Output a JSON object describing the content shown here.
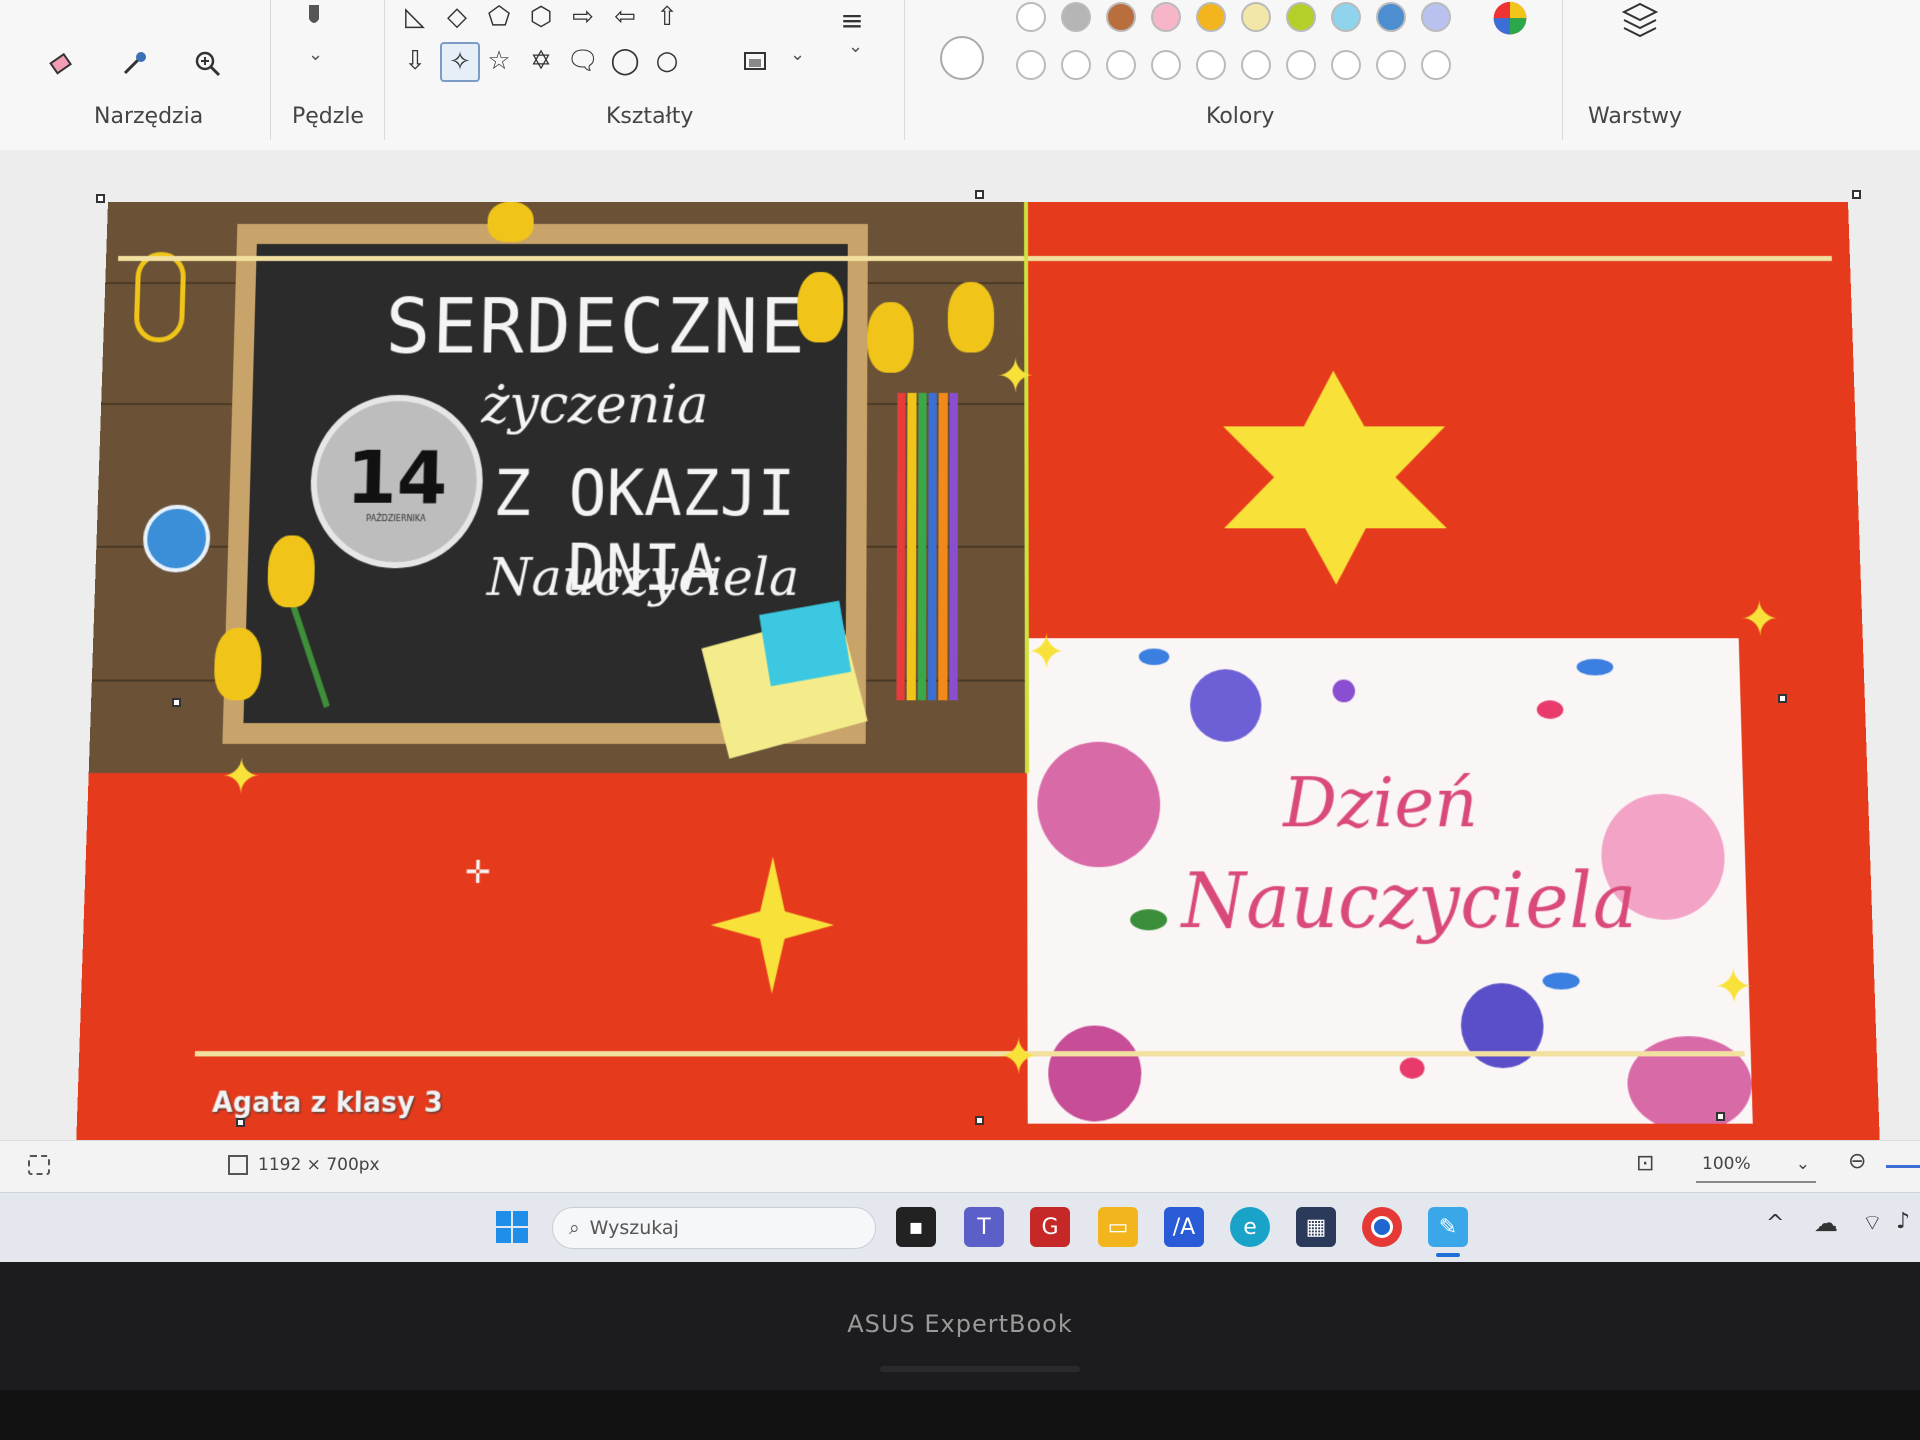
{
  "ribbon": {
    "groups": {
      "tools": "Narzędzia",
      "brushes": "Pędzle",
      "shapes": "Kształty",
      "colors": "Kolory",
      "layers": "Warstwy"
    },
    "palette_row1": [
      "#ffffff",
      "#b5b5b5",
      "#b86f3d",
      "#f6b6c8",
      "#f2b51d",
      "#f2e6a8",
      "#b5cf2a",
      "#8fd3ec",
      "#4c8ed0",
      "#b9c2ee"
    ],
    "palette_row2": [
      "#ffffff",
      "#ffffff",
      "#ffffff",
      "#ffffff",
      "#ffffff",
      "#ffffff",
      "#ffffff",
      "#ffffff",
      "#ffffff",
      "#ffffff"
    ]
  },
  "card": {
    "chalk_line1": "SERDECZNE",
    "chalk_line2": "życzenia",
    "chalk_line3": "Z OKAZJI DNIA",
    "chalk_line4": "Nauczyciela",
    "badge_number": "14",
    "badge_month": "PAŹDZIERNIKA",
    "dzien_line1": "Dzień",
    "dzien_line2": "Nauczyciela",
    "signature": "Agata z klasy 3",
    "colors": {
      "background": "#e63a1c",
      "star": "#f8e23a",
      "gold_line": "#f2e0a0"
    }
  },
  "status": {
    "dimensions": "1192 × 700px",
    "zoom": "100%"
  },
  "taskbar": {
    "search_placeholder": "Wyszukaj"
  },
  "device": {
    "brand": "ASUS ExpertBook"
  }
}
